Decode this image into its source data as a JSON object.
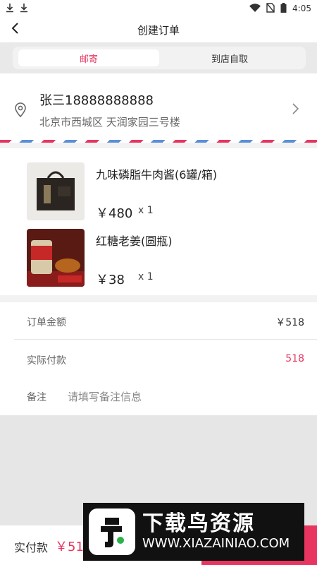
{
  "status_bar": {
    "time": "4:05"
  },
  "header": {
    "title": "创建订单",
    "back_icon": "chevron-left"
  },
  "delivery_tabs": [
    {
      "label": "邮寄",
      "active": true
    },
    {
      "label": "到店自取",
      "active": false
    }
  ],
  "address": {
    "name_phone": "张三18888888888",
    "detail": "北京市西城区 天润家园三号楼"
  },
  "products": [
    {
      "name": "九味磷脂牛肉酱(6罐/箱)",
      "price": "￥480",
      "quantity": "x 1"
    },
    {
      "name": "红糖老姜(圆瓶)",
      "price": "￥38",
      "quantity": "x 1"
    }
  ],
  "summary": {
    "order_amount_label": "订单金额",
    "order_amount_value": "￥518",
    "actual_pay_label": "实际付款",
    "actual_pay_value": "518",
    "remark_label": "备注",
    "remark_placeholder": "请填写备注信息"
  },
  "bottom_bar": {
    "pay_label": "实付款",
    "pay_amount": "￥51"
  },
  "watermark": {
    "title": "下载鸟资源",
    "url": "WWW.XIAZAINIAO.COM"
  },
  "colors": {
    "accent": "#e8355f",
    "airmail_blue": "#5b8fd6"
  }
}
